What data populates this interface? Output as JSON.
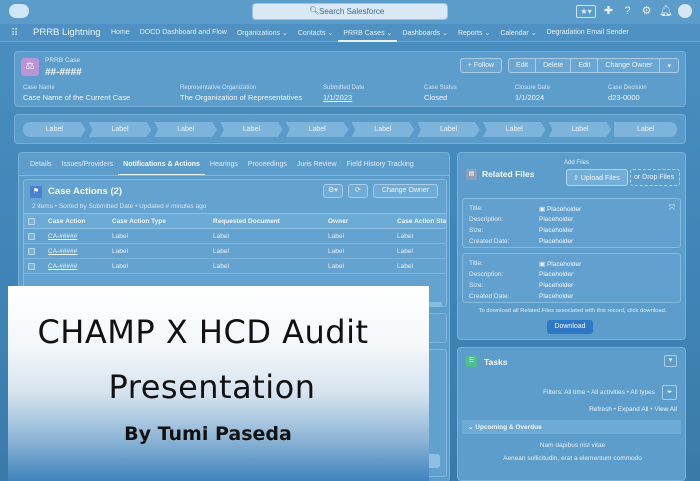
{
  "topbar": {
    "search_placeholder": "Search Salesforce",
    "icons": [
      "star-icon",
      "add-icon",
      "help-icon",
      "gear-icon",
      "bell-icon",
      "avatar"
    ]
  },
  "navbar": {
    "app_name": "PRRB Lightning",
    "items": [
      {
        "label": "Home"
      },
      {
        "label": "DOCD Dashboard and Flow"
      },
      {
        "label": "Organizations"
      },
      {
        "label": "Contacts"
      },
      {
        "label": "PRRB Cases"
      },
      {
        "label": "Dashboards"
      },
      {
        "label": "Reports"
      },
      {
        "label": "Calendar"
      },
      {
        "label": "Degradation Email Sender"
      }
    ],
    "chevron": "⌄"
  },
  "record": {
    "type_label": "PRRB Case",
    "number": "##-####",
    "buttons": {
      "follow": "+ Follow",
      "edit": "Edit",
      "delete": "Delete",
      "edit2": "Edit",
      "change_owner": "Change Owner",
      "more": "▾"
    },
    "fields": [
      {
        "label": "Case Name",
        "value": "Case Name of the Current Case"
      },
      {
        "label": "Representative Organization",
        "value": "The Organization of Representatives"
      },
      {
        "label": "Submitted Date",
        "value": "1/1/2023"
      },
      {
        "label": "Case Status",
        "value": "Closed"
      },
      {
        "label": "Closure Date",
        "value": "1/1/2024"
      },
      {
        "label": "Case Decision",
        "value": "d23-0000"
      }
    ]
  },
  "path": {
    "steps": [
      "Label",
      "Label",
      "Label",
      "Label",
      "Label",
      "Label",
      "Label",
      "Label",
      "Label",
      "Label"
    ]
  },
  "main": {
    "tabs": [
      "Details",
      "Issues/Providers",
      "Notifications & Actions",
      "Hearings",
      "Proceedings",
      "Juris Review",
      "Field History Tracking"
    ],
    "case_actions": {
      "title": "Case Actions (2)",
      "subtitle": "2 items • Sorted by Submitted Date • Updated # minutes ago",
      "gear_label": "⚙▾",
      "refresh_label": "⟳",
      "change_owner": "Change Owner",
      "columns": [
        "Case Action",
        "Case Action Type",
        "Requested Document",
        "Owner",
        "Case Action Sta"
      ],
      "rows": [
        {
          "action": "CA-#####",
          "type": "Label",
          "doc": "Label",
          "owner": "Label",
          "status": "Label"
        },
        {
          "action": "CA-#####",
          "type": "Label",
          "doc": "Label",
          "owner": "Label",
          "status": "Label"
        },
        {
          "action": "CA-#####",
          "type": "Label",
          "doc": "Label",
          "owner": "Label",
          "status": "Label"
        }
      ]
    }
  },
  "related_files": {
    "title": "Related Files",
    "add_files": "Add Files",
    "upload": "Upload Files",
    "drop": "or Drop Files",
    "files": [
      {
        "title_label": "Title:",
        "title": "Placeholder",
        "desc_label": "Description:",
        "desc": "Placeholder",
        "size_label": "Size:",
        "size": "Placeholder",
        "created_label": "Created Date:",
        "created": "Placeholder"
      },
      {
        "title_label": "Title:",
        "title": "Placeholder",
        "desc_label": "Description:",
        "desc": "Placeholder",
        "size_label": "Size:",
        "size": "Placeholder",
        "created_label": "Created Date:",
        "created": "Placeholder"
      }
    ],
    "note": "To download all Related Files associated with this record, click download.",
    "download": "Download"
  },
  "tasks": {
    "title": "Tasks",
    "filters": "Filters: All time • All activities • All types",
    "links": "Refresh • Expand All • View All",
    "section": "Upcoming & Overdue",
    "line1": "Nam dapibus nisl vitae",
    "line2": "Aenean sollicitudin, erat a elementum commodo"
  },
  "overlay": {
    "line1": "CHAMP X HCD Audit",
    "line2": "Presentation",
    "line3": "By Tumi Paseda"
  }
}
